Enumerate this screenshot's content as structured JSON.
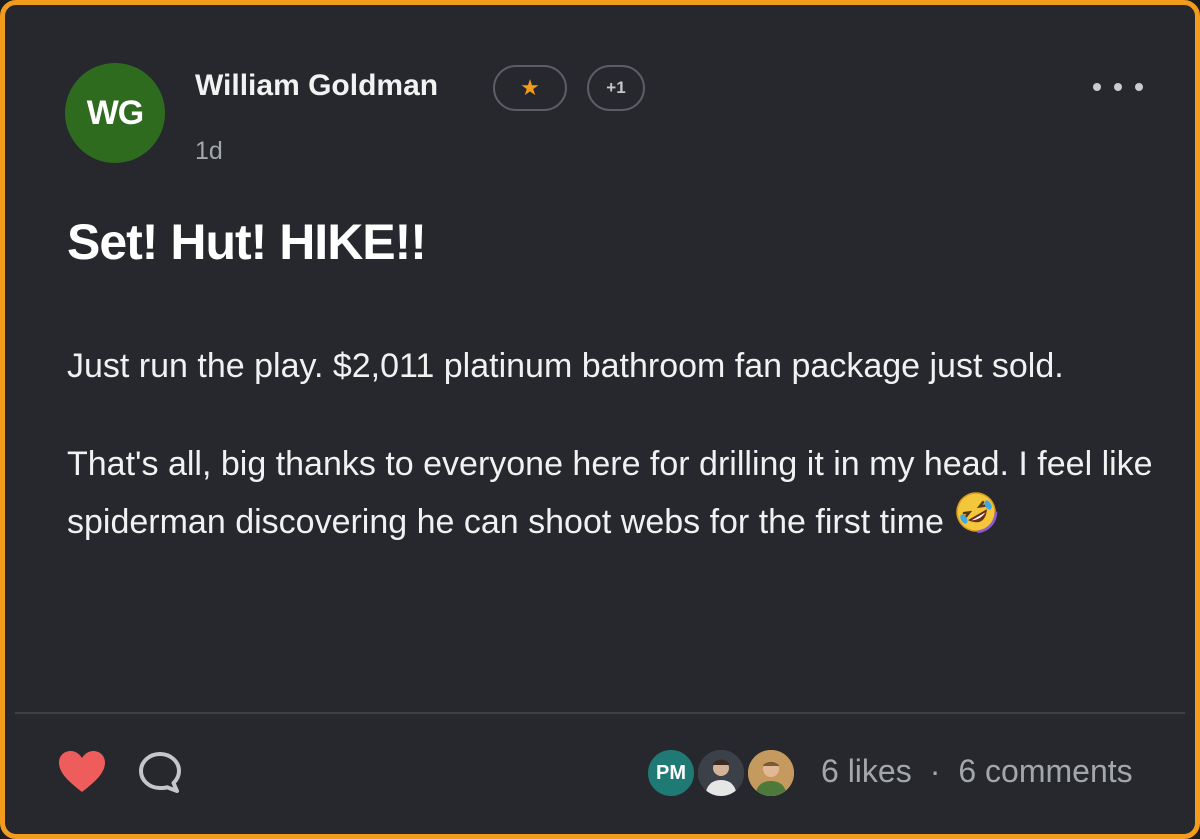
{
  "post": {
    "author": {
      "initials": "WG",
      "name": "William Goldman",
      "avatar_color": "#2e6b1f"
    },
    "badge_star_icon": "star-icon",
    "badge_star_color": "#f39b1c",
    "badge_plus": "+1",
    "time": "1d",
    "more_icon": "more-horizontal-icon",
    "title": "Set! Hut! HIKE!!",
    "paragraphs": [
      "Just run the play. $2,011 platinum bathroom fan package just sold.",
      "That's all, big thanks to everyone here for drilling it in my head. I feel like spiderman discovering he can shoot webs for the first time"
    ],
    "emoji_icon": "rolling-on-floor-laughing-emoji"
  },
  "footer": {
    "like_icon": "heart-icon",
    "like_color": "#ee5c5c",
    "comment_icon": "comment-bubble-icon",
    "likers": [
      {
        "initials": "PM",
        "color": "#1f7a76"
      },
      {
        "icon": "user-photo-avatar"
      },
      {
        "icon": "user-photo-avatar"
      }
    ],
    "likes": "6 likes",
    "separator": "·",
    "comments": "6 comments"
  },
  "theme": {
    "card_border": "#f39b1c",
    "card_background": "#26282d"
  }
}
